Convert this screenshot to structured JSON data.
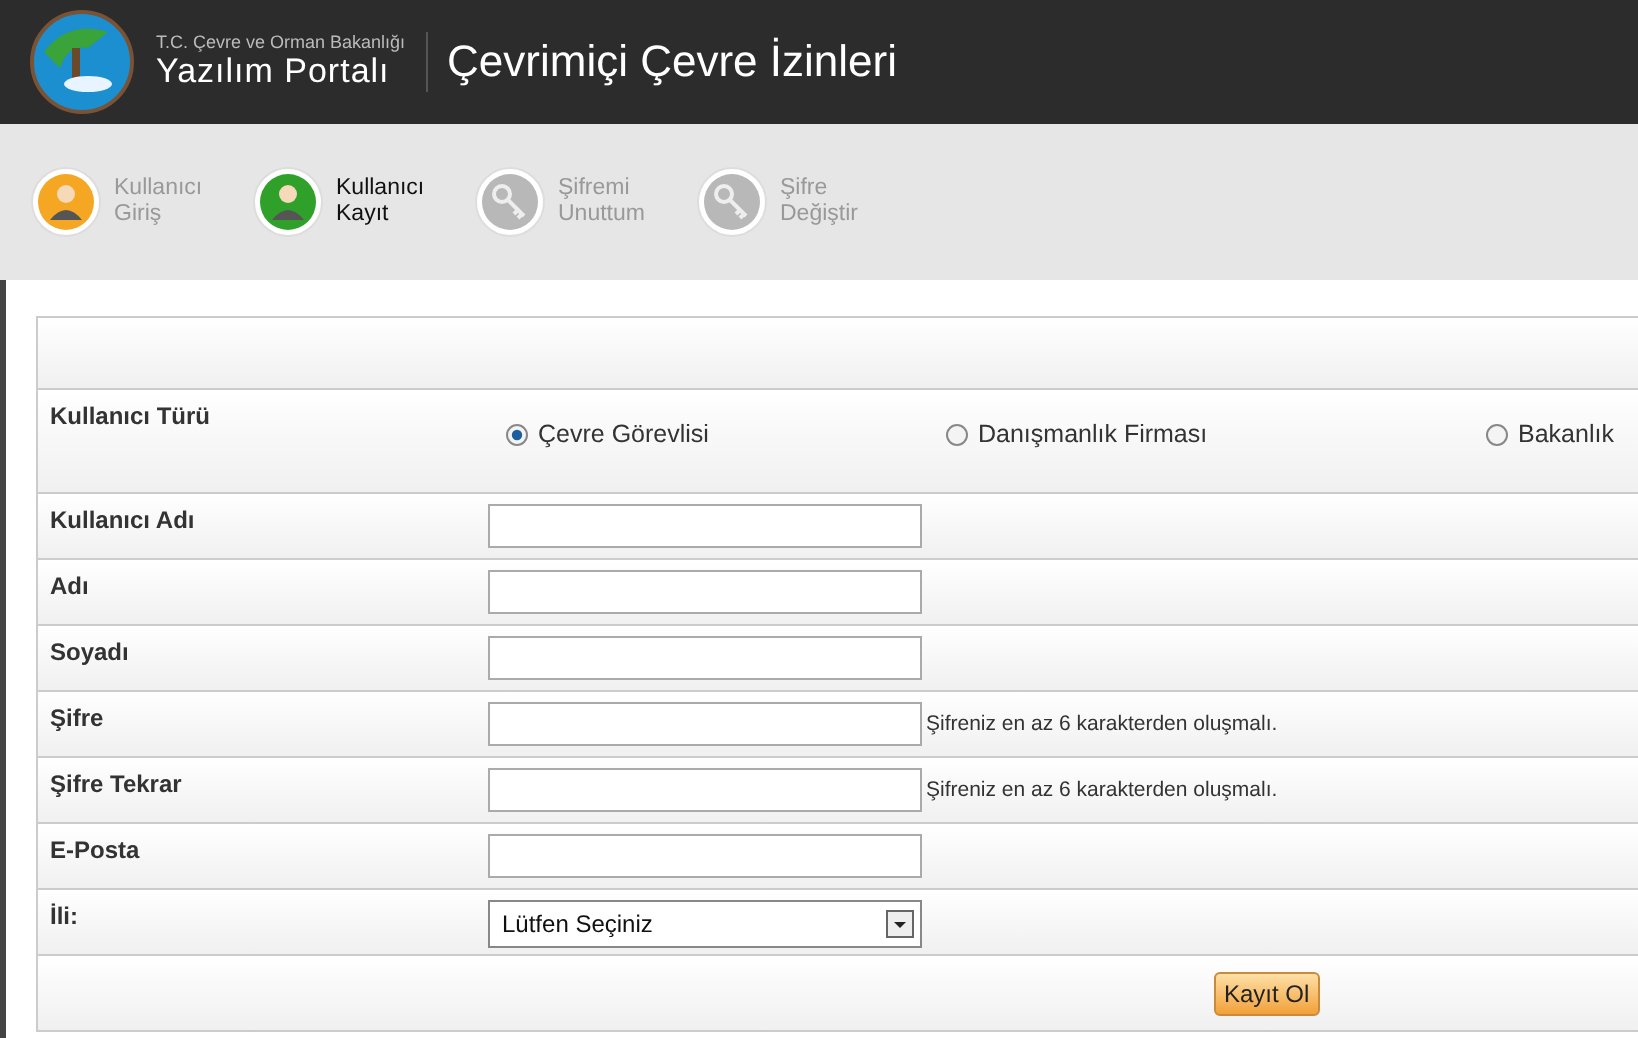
{
  "header": {
    "ministry": "T.C. Çevre ve Orman Bakanlığı",
    "portal": "Yazılım Portalı",
    "title": "Çevrimiçi Çevre İzinleri"
  },
  "nav": [
    {
      "kind": "login",
      "line1": "Kullanıcı",
      "line2": "Giriş",
      "selected": false,
      "disabled": false
    },
    {
      "kind": "register",
      "line1": "Kullanıcı",
      "line2": "Kayıt",
      "selected": true,
      "disabled": false
    },
    {
      "kind": "forgot",
      "line1": "Şifremi",
      "line2": "Unuttum",
      "selected": false,
      "disabled": true
    },
    {
      "kind": "change",
      "line1": "Şifre",
      "line2": "Değiştir",
      "selected": false,
      "disabled": true
    }
  ],
  "user_type": {
    "label": "Kullanıcı Türü",
    "options": [
      {
        "label": "Çevre Görevlisi",
        "selected": true
      },
      {
        "label": "Danışmanlık Firması",
        "selected": false
      },
      {
        "label": "Bakanlık",
        "selected": false
      }
    ]
  },
  "fields": [
    {
      "kind": "text",
      "label": "Kullanıcı Adı"
    },
    {
      "kind": "text",
      "label": "Adı"
    },
    {
      "kind": "text",
      "label": "Soyadı"
    },
    {
      "kind": "text",
      "label": "Şifre",
      "hint": "Şifreniz en az 6 karakterden oluşmalı."
    },
    {
      "kind": "text",
      "label": "Şifre Tekrar",
      "hint": "Şifreniz en az 6 karakterden oluşmalı."
    },
    {
      "kind": "text",
      "label": "E-Posta"
    },
    {
      "kind": "select",
      "label": "İli:",
      "value": "Lütfen Seçiniz"
    }
  ],
  "submit": "Kayıt Ol"
}
